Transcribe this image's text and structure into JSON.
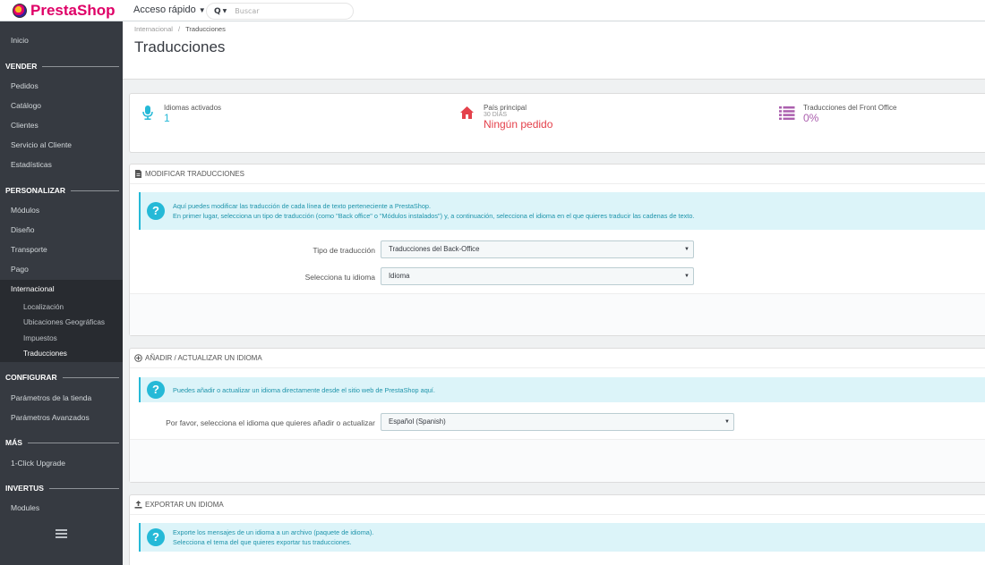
{
  "header": {
    "brand": "PrestaShop",
    "quick_access": "Acceso rápido",
    "search_placeholder": "Buscar"
  },
  "sidebar": {
    "inicio": "Inicio",
    "sections": {
      "vender": "VENDER",
      "personalizar": "PERSONALIZAR",
      "configurar": "CONFIGURAR",
      "mas": "MÁS",
      "invertus": "INVERTUS"
    },
    "vender_items": [
      "Pedidos",
      "Catálogo",
      "Clientes",
      "Servicio al Cliente",
      "Estadísticas"
    ],
    "personalizar_items": [
      "Módulos",
      "Diseño",
      "Transporte",
      "Pago"
    ],
    "internacional": "Internacional",
    "internacional_sub": [
      "Localización",
      "Ubicaciones Geográficas",
      "Impuestos",
      "Traducciones"
    ],
    "configurar_items": [
      "Parámetros de la tienda",
      "Parámetros Avanzados"
    ],
    "mas_items": [
      "1-Click Upgrade"
    ],
    "invertus_items": [
      "Modules"
    ]
  },
  "breadcrumb": {
    "parent": "Internacional",
    "separator": "/",
    "current": "Traducciones"
  },
  "page_title": "Traducciones",
  "kpis": {
    "languages": {
      "label": "Idiomas activados",
      "value": "1",
      "color": "#25b9d7"
    },
    "country": {
      "label": "País principal",
      "sub": "30 DÍAS",
      "value": "Ningún pedido",
      "color": "#e4414b"
    },
    "front": {
      "label": "Traducciones del Front Office",
      "value": "0%",
      "color": "#ab5fae"
    }
  },
  "panel_modify": {
    "title": "MODIFICAR TRADUCCIONES",
    "alert_line1": "Aquí puedes modificar las traducción de cada línea de texto perteneciente a PrestaShop.",
    "alert_line2": "En primer lugar, selecciona un tipo de traducción (como \"Back office\" o \"Módulos instalados\") y, a continuación, selecciona el idioma en el que quieres traducir las cadenas de texto.",
    "type_label": "Tipo de traducción",
    "type_value": "Traducciones del Back-Office",
    "lang_label": "Selecciona tu idioma",
    "lang_value": "Idioma"
  },
  "panel_add": {
    "title": "AÑADIR / ACTUALIZAR UN IDIOMA",
    "alert": "Puedes añadir o actualizar un idioma directamente desde el sitio web de PrestaShop aquí.",
    "select_label": "Por favor, selecciona el idioma que quieres añadir o actualizar",
    "select_value": "Español (Spanish)"
  },
  "panel_export": {
    "title": "EXPORTAR UN IDIOMA",
    "alert_line1": "Exporte los mensajes de un idioma a un archivo (paquete de idioma).",
    "alert_line2": "Selecciona el tema del que quieres exportar tus traducciones."
  }
}
